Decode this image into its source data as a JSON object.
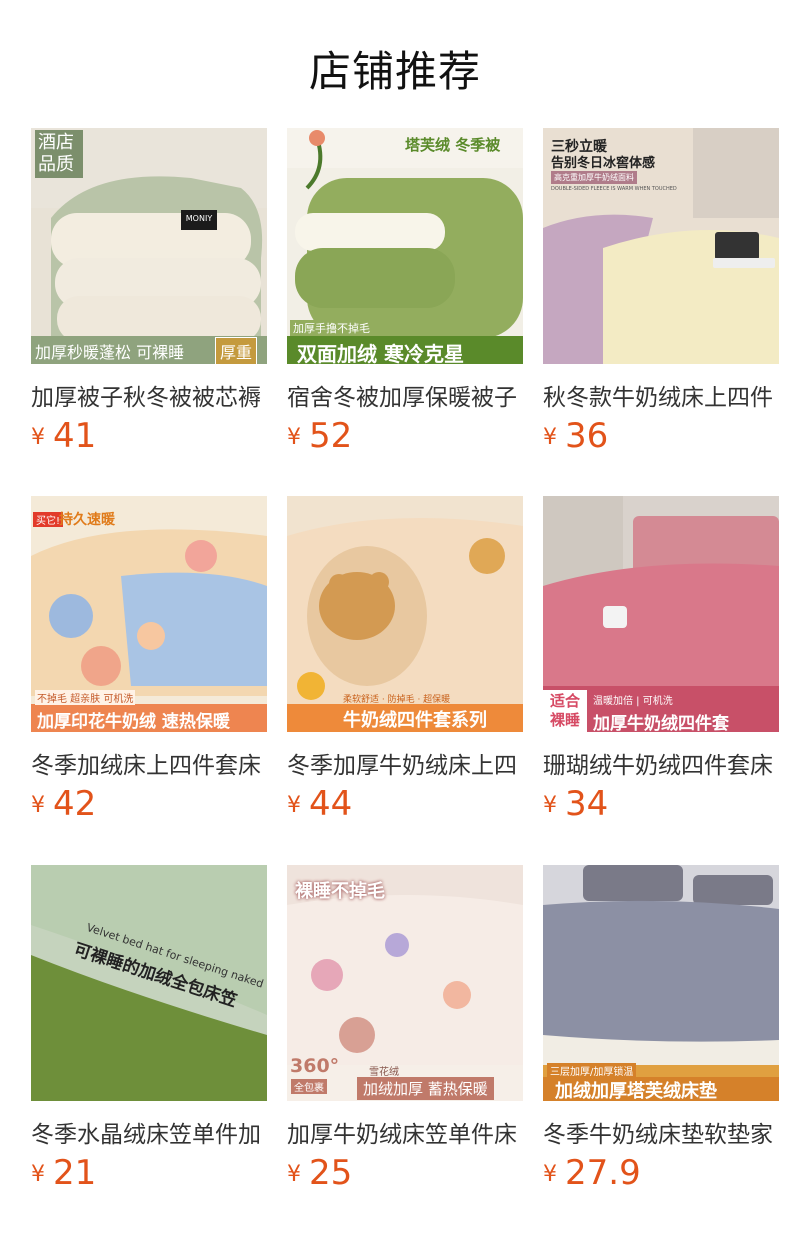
{
  "section_title": "店铺推荐",
  "currency": "¥",
  "colors": {
    "price": "#e2531a",
    "title": "#111111",
    "text": "#333333"
  },
  "products": [
    {
      "name": "加厚被子秋冬被被芯褥",
      "price": "41",
      "overlay": {
        "badge": "酒店品质",
        "bottom": "加厚秒暖蓬松 可裸睡",
        "bottom_tag": "厚重",
        "brand": "MONIY"
      }
    },
    {
      "name": "宿舍冬被加厚保暖被子",
      "price": "52",
      "overlay": {
        "top": "塔芙绒 冬季被",
        "small": "加厚手撸不掉毛",
        "bottom": "双面加绒 寒冷克星"
      }
    },
    {
      "name": "秋冬款牛奶绒床上四件",
      "price": "36",
      "overlay": {
        "top1": "三秒立暖",
        "top2": "告别冬日冰窖体感",
        "small": "高克重加厚牛奶绒面料",
        "small_en": "DOUBLE-SIDED FLEECE IS WARM WHEN TOUCHED"
      }
    },
    {
      "name": "冬季加绒床上四件套床",
      "price": "42",
      "overlay": {
        "badge": "买它!",
        "top": "持久速暖",
        "small": "不掉毛 超亲肤 可机洗",
        "bottom": "加厚印花牛奶绒 速热保暖"
      }
    },
    {
      "name": "冬季加厚牛奶绒床上四",
      "price": "44",
      "overlay": {
        "small": "柔软舒适 · 防掉毛 · 超保暖",
        "bottom": "牛奶绒四件套系列"
      }
    },
    {
      "name": "珊瑚绒牛奶绒四件套床",
      "price": "34",
      "overlay": {
        "badge": "适合裸睡",
        "small": "温暖加倍 | 可机洗",
        "bottom": "加厚牛奶绒四件套"
      }
    },
    {
      "name": "冬季水晶绒床笠单件加",
      "price": "21",
      "overlay": {
        "en": "Velvet bed hat for sleeping naked",
        "cn": "可裸睡的加绒全包床笠"
      }
    },
    {
      "name": "加厚牛奶绒床笠单件床",
      "price": "25",
      "overlay": {
        "top": "裸睡不掉毛",
        "deg": "360°",
        "deg_sub": "全包裹",
        "small": "雪花绒",
        "bottom": "加绒加厚 蓄热保暖"
      }
    },
    {
      "name": "冬季牛奶绒床垫软垫家",
      "price": "27.9",
      "overlay": {
        "small": "三层加厚/加厚锁温",
        "bottom": "加绒加厚塔芙绒床垫"
      }
    }
  ]
}
